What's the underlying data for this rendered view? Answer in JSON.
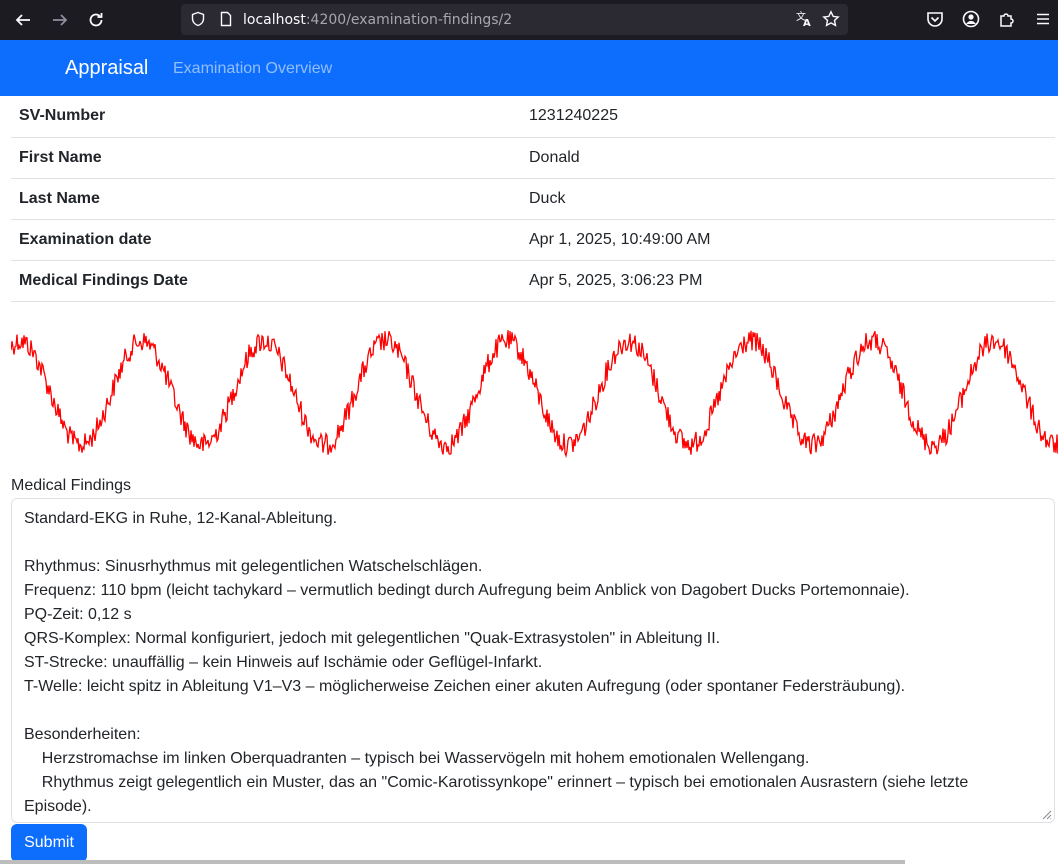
{
  "browser": {
    "url_host": "localhost",
    "url_path": ":4200/examination-findings/2"
  },
  "navbar": {
    "brand": "Appraisal",
    "link": "Examination Overview",
    "color": "#0d6efd"
  },
  "patient": [
    {
      "label": "SV-Number",
      "value": "1231240225"
    },
    {
      "label": "First Name",
      "value": "Donald"
    },
    {
      "label": "Last Name",
      "value": "Duck"
    },
    {
      "label": "Examination date",
      "value": "Apr 1, 2025, 10:49:00 AM"
    },
    {
      "label": "Medical Findings Date",
      "value": "Apr 5, 2025, 3:06:23 PM"
    }
  ],
  "ecg": {
    "stroke_color": "#ff0000",
    "cycles": 8.6
  },
  "findings": {
    "label": "Medical Findings",
    "text": "Standard-EKG in Ruhe, 12-Kanal-Ableitung.\n\nRhythmus: Sinusrhythmus mit gelegentlichen Watschelschlägen.\nFrequenz: 110 bpm (leicht tachykard – vermutlich bedingt durch Aufregung beim Anblick von Dagobert Ducks Portemonnaie).\nPQ-Zeit: 0,12 s\nQRS-Komplex: Normal konfiguriert, jedoch mit gelegentlichen \"Quak-Extrasystolen\" in Ableitung II.\nST-Strecke: unauffällig – kein Hinweis auf Ischämie oder Geflügel-Infarkt.\nT-Welle: leicht spitz in Ableitung V1–V3 – möglicherweise Zeichen einer akuten Aufregung (oder spontaner Federsträubung).\n\nBesonderheiten:\n    Herzstromachse im linken Oberquadranten – typisch bei Wasservögeln mit hohem emotionalen Wellengang.\n    Rhythmus zeigt gelegentlich ein Muster, das an \"Comic-Karotissynkope\" erinnert – typisch bei emotionalen Ausrastern (siehe letzte Episode).\n    Keine Anzeichen einer A-Flatter (aber deutlicher Hinweis auf A-Quaken)."
  },
  "submit_label": "Submit"
}
